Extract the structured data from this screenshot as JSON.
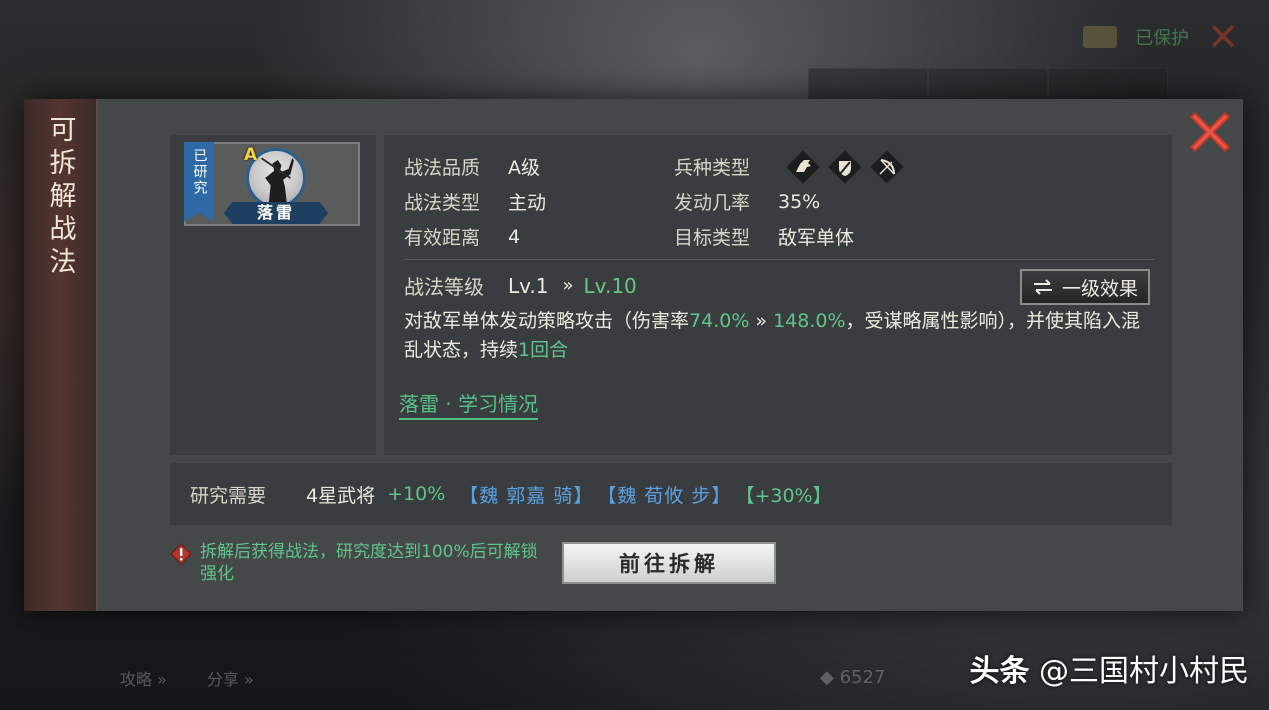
{
  "background": {
    "protect_text": "已保护",
    "bottom_items": [
      "攻略 »",
      "分享 »"
    ],
    "diamond_value": "6527"
  },
  "dialog": {
    "side_title": "可拆解战法",
    "card": {
      "researched_tag": "已研究",
      "grade": "A",
      "name": "落雷"
    },
    "info": {
      "quality_label": "战法品质",
      "quality_value": "A级",
      "type_label": "战法类型",
      "type_value": "主动",
      "range_label": "有效距离",
      "range_value": "4",
      "troop_label": "兵种类型",
      "troop_icons": [
        "cavalry-icon",
        "shield-icon",
        "bow-icon"
      ],
      "rate_label": "发动几率",
      "rate_value": "35%",
      "target_label": "目标类型",
      "target_value": "敌军单体"
    },
    "level": {
      "label": "战法等级",
      "from": "Lv.1",
      "arrow": "»",
      "to": "Lv.10",
      "effect_button": "一级效果"
    },
    "description": {
      "part1": "对敌军单体发动策略攻击（伤害率",
      "rate_from": "74.0%",
      "arrow": " » ",
      "rate_to": "148.0%",
      "part2": "，受谋略属性影响），并使其陷入混乱状态，持续",
      "duration": "1回合"
    },
    "learn_link": "落雷 · 学习情况",
    "requirement": {
      "label": "研究需要",
      "value": "4星武将",
      "bonus": "+10%",
      "general1": "【魏 郭嘉 骑】",
      "general2": "【魏 荀攸 步】",
      "extra": "【+30%】"
    },
    "warning": "拆解后获得战法，研究度达到100%后可解锁强化",
    "go_button": "前往拆解"
  },
  "watermark": {
    "brand": "头条",
    "account": "@三国村小村民"
  }
}
